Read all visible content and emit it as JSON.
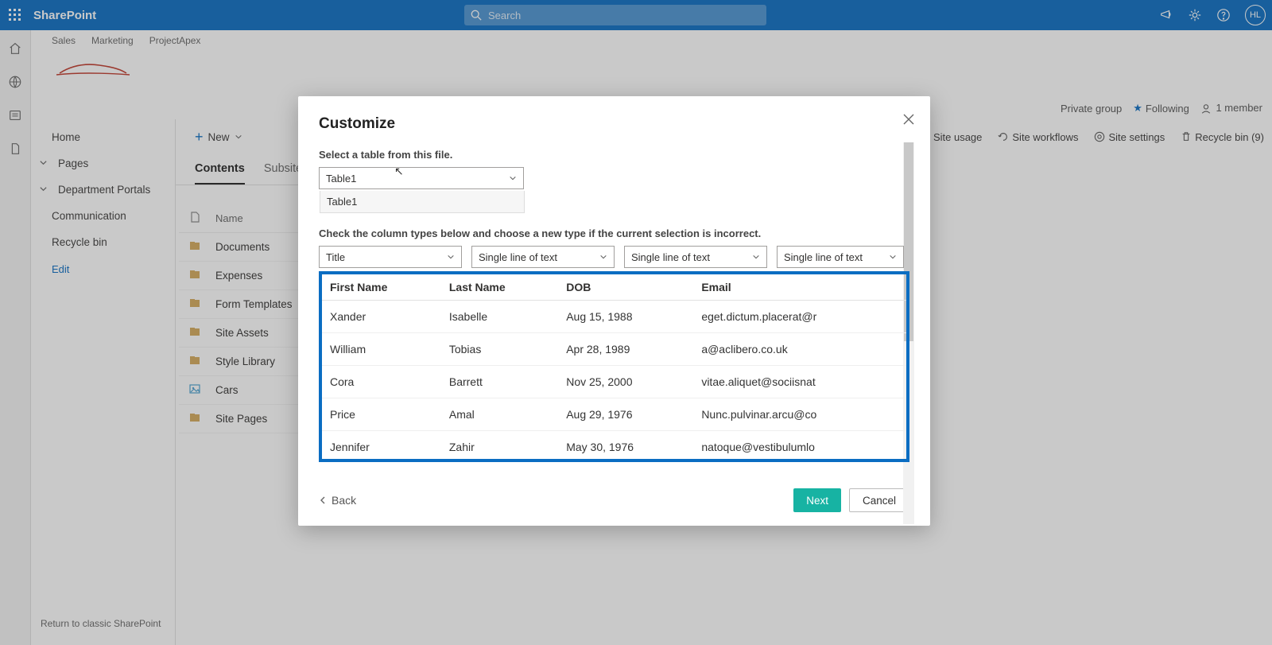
{
  "topbar": {
    "brand": "SharePoint",
    "search_placeholder": "Search",
    "avatar": "HL"
  },
  "subnav": [
    "Sales",
    "Marketing",
    "ProjectApex"
  ],
  "siteinfo": {
    "group": "Private group",
    "following": "Following",
    "members": "1 member"
  },
  "leftnav": {
    "home": "Home",
    "pages": "Pages",
    "dept": "Department Portals",
    "comm": "Communication",
    "recycle": "Recycle bin",
    "edit": "Edit",
    "return": "Return to classic SharePoint"
  },
  "cmdbar": {
    "new": "New",
    "usage": "Site usage",
    "workflows": "Site workflows",
    "settings": "Site settings",
    "recycle": "Recycle bin (9)"
  },
  "tabs": {
    "contents": "Contents",
    "subsites": "Subsites"
  },
  "table": {
    "header": "Name",
    "rows": [
      "Documents",
      "Expenses",
      "Form Templates",
      "Site Assets",
      "Style Library",
      "Cars",
      "Site Pages"
    ]
  },
  "modal": {
    "title": "Customize",
    "select_label": "Select a table from this file.",
    "table_value": "Table1",
    "table_option": "Table1",
    "check_label": "Check the column types below and choose a new type if the current selection is incorrect.",
    "coltypes": [
      "Title",
      "Single line of text",
      "Single line of text",
      "Single line of text"
    ],
    "headers": [
      "First Name",
      "Last Name",
      "DOB",
      "Email"
    ],
    "rows": [
      {
        "fn": "Xander",
        "ln": "Isabelle",
        "dob": "Aug 15, 1988",
        "em": "eget.dictum.placerat@r"
      },
      {
        "fn": "William",
        "ln": "Tobias",
        "dob": "Apr 28, 1989",
        "em": "a@aclibero.co.uk"
      },
      {
        "fn": "Cora",
        "ln": "Barrett",
        "dob": "Nov 25, 2000",
        "em": "vitae.aliquet@sociisnat"
      },
      {
        "fn": "Price",
        "ln": "Amal",
        "dob": "Aug 29, 1976",
        "em": "Nunc.pulvinar.arcu@co"
      },
      {
        "fn": "Jennifer",
        "ln": "Zahir",
        "dob": "May 30, 1976",
        "em": "natoque@vestibulumlo"
      }
    ],
    "back": "Back",
    "next": "Next",
    "cancel": "Cancel"
  }
}
